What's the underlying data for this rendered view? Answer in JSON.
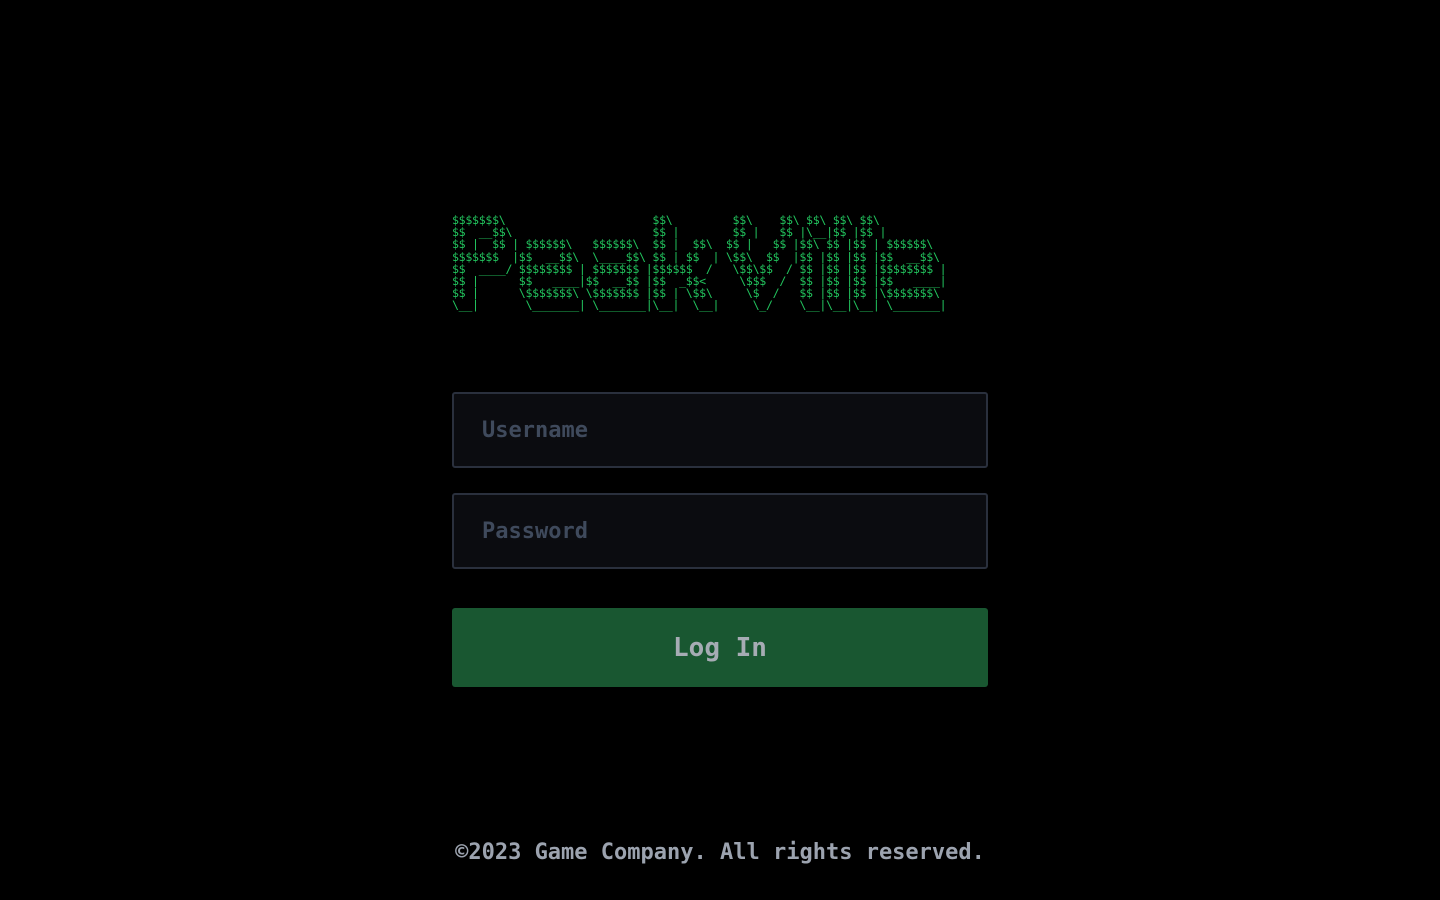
{
  "logo": {
    "ascii_art": "$$$$$$$\\                      $$\\         $$\\    $$\\ $$\\ $$\\ $$\\ \n$$  __$$\\                     $$ |        $$ |   $$ |\\__|$$ |$$ |\n$$ |  $$ | $$$$$$\\   $$$$$$\\  $$ |  $$\\  $$ |   $$ |$$\\ $$ |$$ | $$$$$$\\\n$$$$$$$  |$$  __$$\\  \\____$$\\ $$ | $$  | \\$$\\  $$  |$$ |$$ |$$ |$$  __$$\\\n$$  ____/ $$$$$$$$ | $$$$$$$ |$$$$$$  /   \\$$\\$$  / $$ |$$ |$$ |$$$$$$$$ |\n$$ |      $$   ____|$$  __$$ |$$  _$$<     \\$$$  /  $$ |$$ |$$ |$$   ____|\n$$ |      \\$$$$$$$\\ \\$$$$$$$ |$$ | \\$$\\     \\$  /   $$ |$$ |$$ |\\$$$$$$$\\\n\\__|       \\_______| \\_______|\\__|  \\__|     \\_/    \\__|\\__|\\__| \\_______|",
    "color": "#22c55e"
  },
  "login_form": {
    "username_placeholder": "Username",
    "username_value": "",
    "password_placeholder": "Password",
    "password_value": "",
    "login_label": "Log In",
    "button_color": "#195731"
  },
  "footer": {
    "copyright": "©2023 Game Company. All rights reserved."
  }
}
